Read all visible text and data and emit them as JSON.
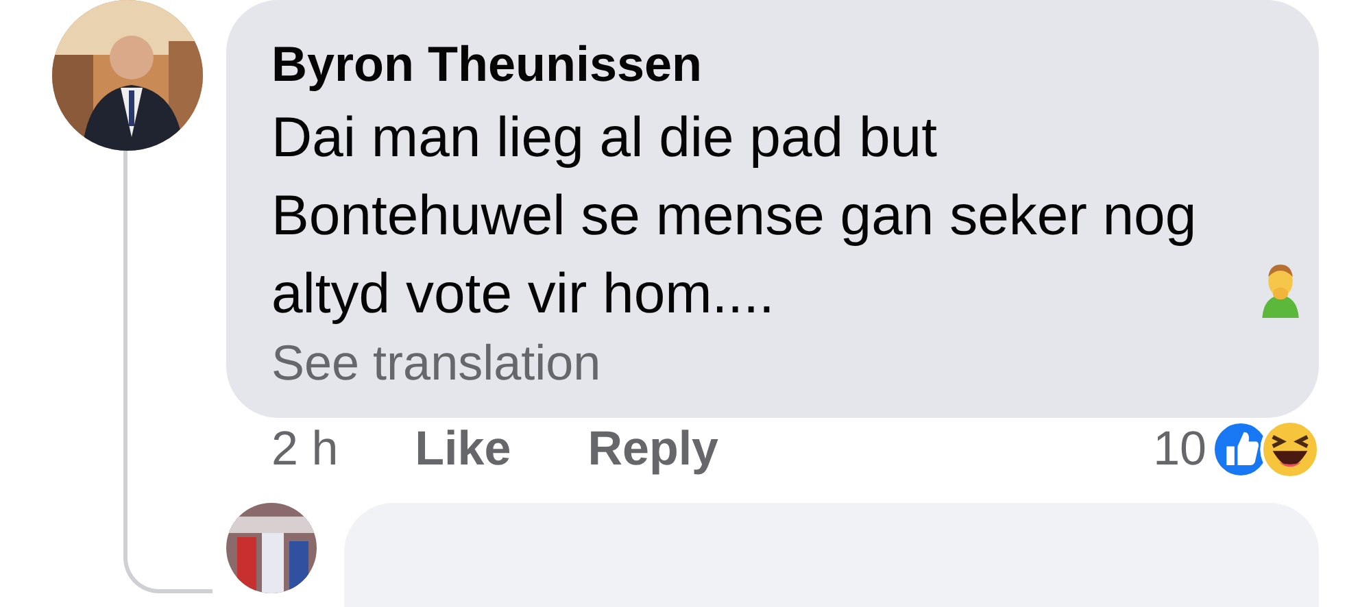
{
  "comment": {
    "author": "Byron Theunissen",
    "text": "Dai man lieg al die pad but Bontehuwel se mense gan seker nog altyd vote vir hom....",
    "see_translation": "See translation",
    "time": "2 h",
    "actions": [
      "Like",
      "Reply"
    ],
    "reaction_count": "10"
  }
}
